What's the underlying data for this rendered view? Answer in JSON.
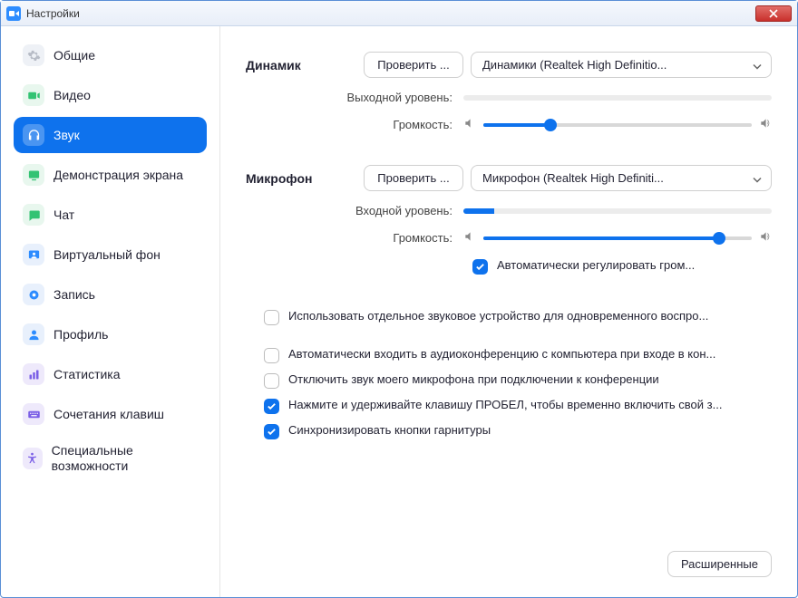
{
  "window": {
    "title": "Настройки"
  },
  "sidebar": {
    "items": [
      {
        "label": "Общие"
      },
      {
        "label": "Видео"
      },
      {
        "label": "Звук"
      },
      {
        "label": "Демонстрация экрана"
      },
      {
        "label": "Чат"
      },
      {
        "label": "Виртуальный фон"
      },
      {
        "label": "Запись"
      },
      {
        "label": "Профиль"
      },
      {
        "label": "Статистика"
      },
      {
        "label": "Сочетания клавиш"
      },
      {
        "label": "Специальные возможности"
      }
    ]
  },
  "speaker": {
    "heading": "Динамик",
    "test_btn": "Проверить ...",
    "device": "Динамики (Realtek High Definitio...",
    "output_level_label": "Выходной уровень:",
    "volume_label": "Громкость:",
    "volume_percent": 25
  },
  "mic": {
    "heading": "Микрофон",
    "test_btn": "Проверить ...",
    "device": "Микрофон (Realtek High Definiti...",
    "input_level_label": "Входной уровень:",
    "input_level_percent": 10,
    "volume_label": "Громкость:",
    "volume_percent": 88,
    "auto_adjust": "Автоматически регулировать гром..."
  },
  "options": {
    "separate_device": "Использовать отдельное звуковое устройство для одновременного воспро...",
    "auto_join_audio": "Автоматически входить в аудиоконференцию с компьютера при входе в кон...",
    "mute_on_join": "Отключить звук моего микрофона при подключении к конференции",
    "spacebar_unmute": "Нажмите и удерживайте клавишу ПРОБЕЛ, чтобы временно включить свой з...",
    "sync_headset": "Синхронизировать кнопки гарнитуры"
  },
  "advanced_btn": "Расширенные",
  "colors": {
    "accent": "#0E72ED"
  }
}
